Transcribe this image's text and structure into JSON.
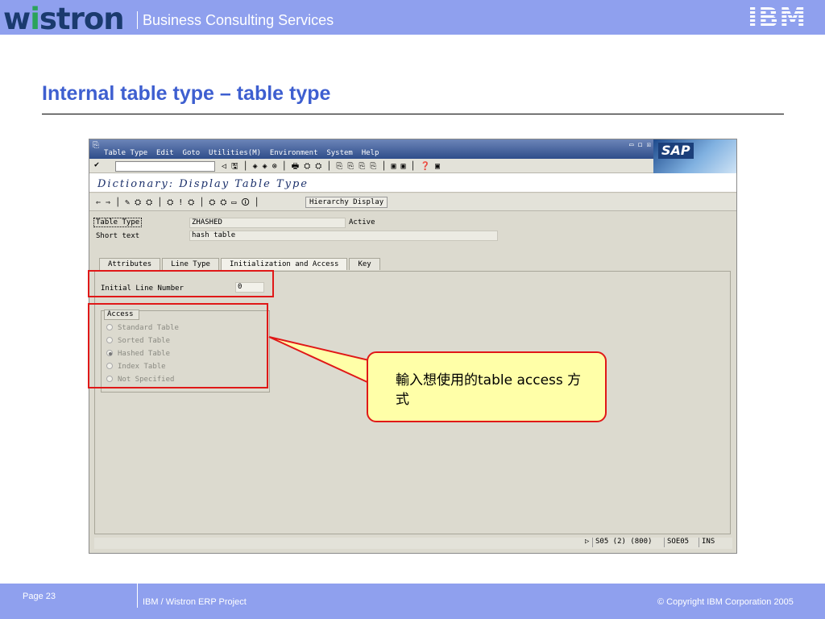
{
  "header": {
    "logo": {
      "pre": "w",
      "accent": "i",
      "post": "stron"
    },
    "division": "Business Consulting Services",
    "ibm_logo": "IBM"
  },
  "slide": {
    "title": "Internal table type – table type"
  },
  "sap": {
    "menu": "Table Type  Edit  Goto  Utilities(M)  Environment  System  Help",
    "window_buttons": "▭ ◻ ☒",
    "logo": "SAP",
    "toolbar_icons_left": "✔",
    "toolbar_icons_right": "◁ 🖫 │ ◈ ◈ ⊗ │ 🖶 ⛭ ⛭ │ ⎘ ⎘ ⎘ ⎘ │ ▣ ▣ │ ❓ ▣",
    "screen_title": "Dictionary: Display Table Type",
    "app_toolbar_icons": "⇐ ⇒ │ ✎ ⛭ ⛭ │ ⛭ ! ⛭ │ ⛭ ⛭ ▭ 🛈 │",
    "hierarchy_button": "Hierarchy Display",
    "fields": {
      "table_type_label": "Table Type",
      "table_type_value": "ZHASHED",
      "status": "Active",
      "short_text_label": "Short text",
      "short_text_value": "hash table"
    },
    "tabs": [
      "Attributes",
      "Line Type",
      "Initialization and Access",
      "Key"
    ],
    "active_tab": "Initialization and Access",
    "initial_line_label": "Initial Line Number",
    "initial_line_value": "0",
    "access": {
      "title": "Access",
      "options": [
        "Standard Table",
        "Sorted Table",
        "Hashed Table",
        "Index Table",
        "Not Specified"
      ],
      "selected": "Hashed Table"
    },
    "status_bar": {
      "arrow": "▷",
      "session": "S05 (2) (800)",
      "server": "SOE05",
      "mode": "INS"
    }
  },
  "callout": {
    "text": "輸入想使用的table access 方式"
  },
  "footer": {
    "page": "Page 23",
    "project": "IBM / Wistron ERP Project",
    "copyright": "© Copyright IBM Corporation 2005"
  },
  "colors": {
    "banner": "#8fa0ee",
    "title": "#3e5fd0",
    "highlight": "#e01818",
    "callout_fill": "#ffffa8"
  }
}
